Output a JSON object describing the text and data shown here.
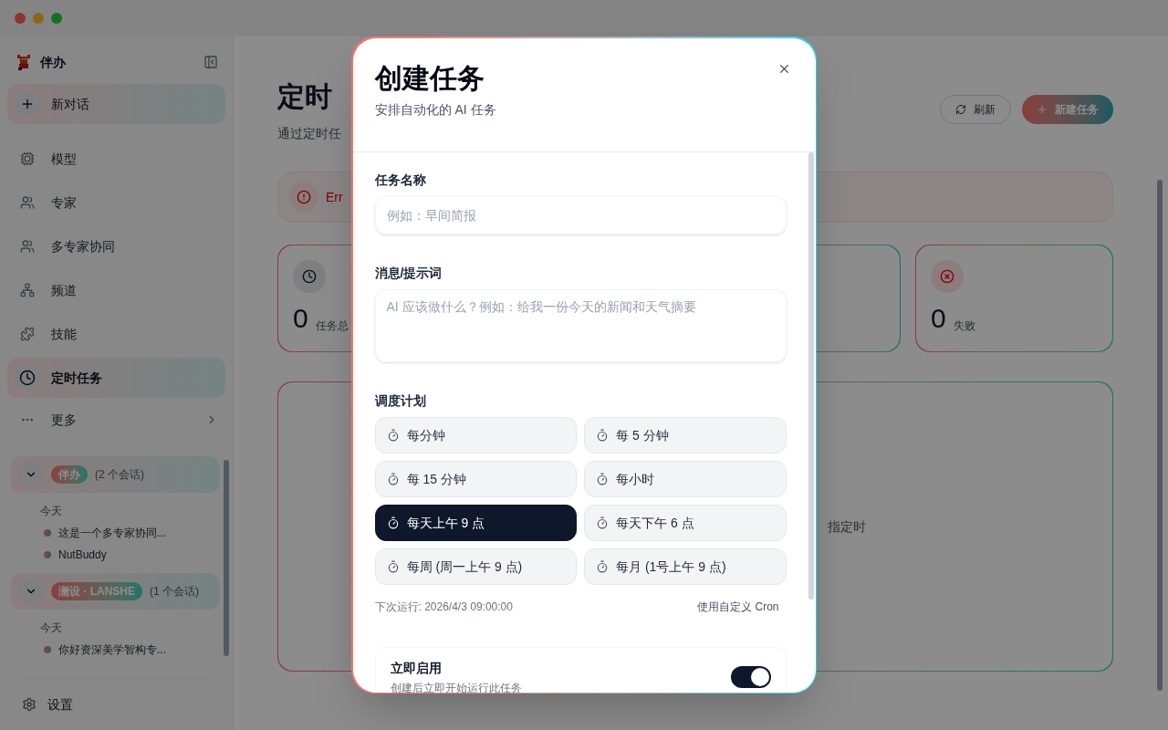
{
  "sidebar": {
    "app_name": "伴办",
    "new_chat": "新对话",
    "nav": [
      {
        "label": "模型",
        "selected": false
      },
      {
        "label": "专家",
        "selected": false
      },
      {
        "label": "多专家协同",
        "selected": false
      },
      {
        "label": "频道",
        "selected": false
      },
      {
        "label": "技能",
        "selected": false
      },
      {
        "label": "定时任务",
        "selected": true
      }
    ],
    "more": "更多",
    "groups": [
      {
        "name": "伴办",
        "count": "(2 个会话)",
        "expanded": true,
        "day": "今天",
        "items": [
          "这是一个多专家协同...",
          "NutBuddy"
        ]
      },
      {
        "name": "澜设 · LANSHE",
        "count": "(1 个会话)",
        "expanded": true,
        "day": "今天",
        "items": [
          "你好资深美学智构专..."
        ]
      }
    ],
    "settings": "设置"
  },
  "page": {
    "title": "定时",
    "subtitle": "通过定时任",
    "refresh": "刷新",
    "new_task": "新建任务",
    "error": "Err",
    "stat_cards": [
      {
        "kind": "total",
        "value": "0",
        "label": "任务总"
      },
      {
        "kind": "covered"
      },
      {
        "kind": "failed",
        "value": "0",
        "label": "失败"
      }
    ],
    "empty_text": "指定时"
  },
  "dialog": {
    "title": "创建任务",
    "subtitle": "安排自动化的 AI 任务",
    "fields": [
      {
        "kind": "input",
        "label": "任务名称",
        "placeholder": "例如：早间简报"
      },
      {
        "kind": "textarea",
        "label": "消息/提示词",
        "placeholder": "AI 应该做什么？例如：给我一份今天的新闻和天气摘要"
      }
    ],
    "schedule": {
      "label": "调度计划",
      "options": [
        {
          "label": "每分钟",
          "selected": false
        },
        {
          "label": "每 5 分钟",
          "selected": false
        },
        {
          "label": "每 15 分钟",
          "selected": false
        },
        {
          "label": "每小时",
          "selected": false
        },
        {
          "label": "每天上午 9 点",
          "selected": true
        },
        {
          "label": "每天下午 6 点",
          "selected": false
        },
        {
          "label": "每周 (周一上午 9 点)",
          "selected": false
        },
        {
          "label": "每月 (1号上午 9 点)",
          "selected": false
        }
      ],
      "next_run": "下次运行: 2026/4/3 09:00:00",
      "custom_link": "使用自定义 Cron"
    },
    "enable": {
      "title": "立即启用",
      "description": "创建后立即开始运行此任务",
      "on": true
    }
  }
}
